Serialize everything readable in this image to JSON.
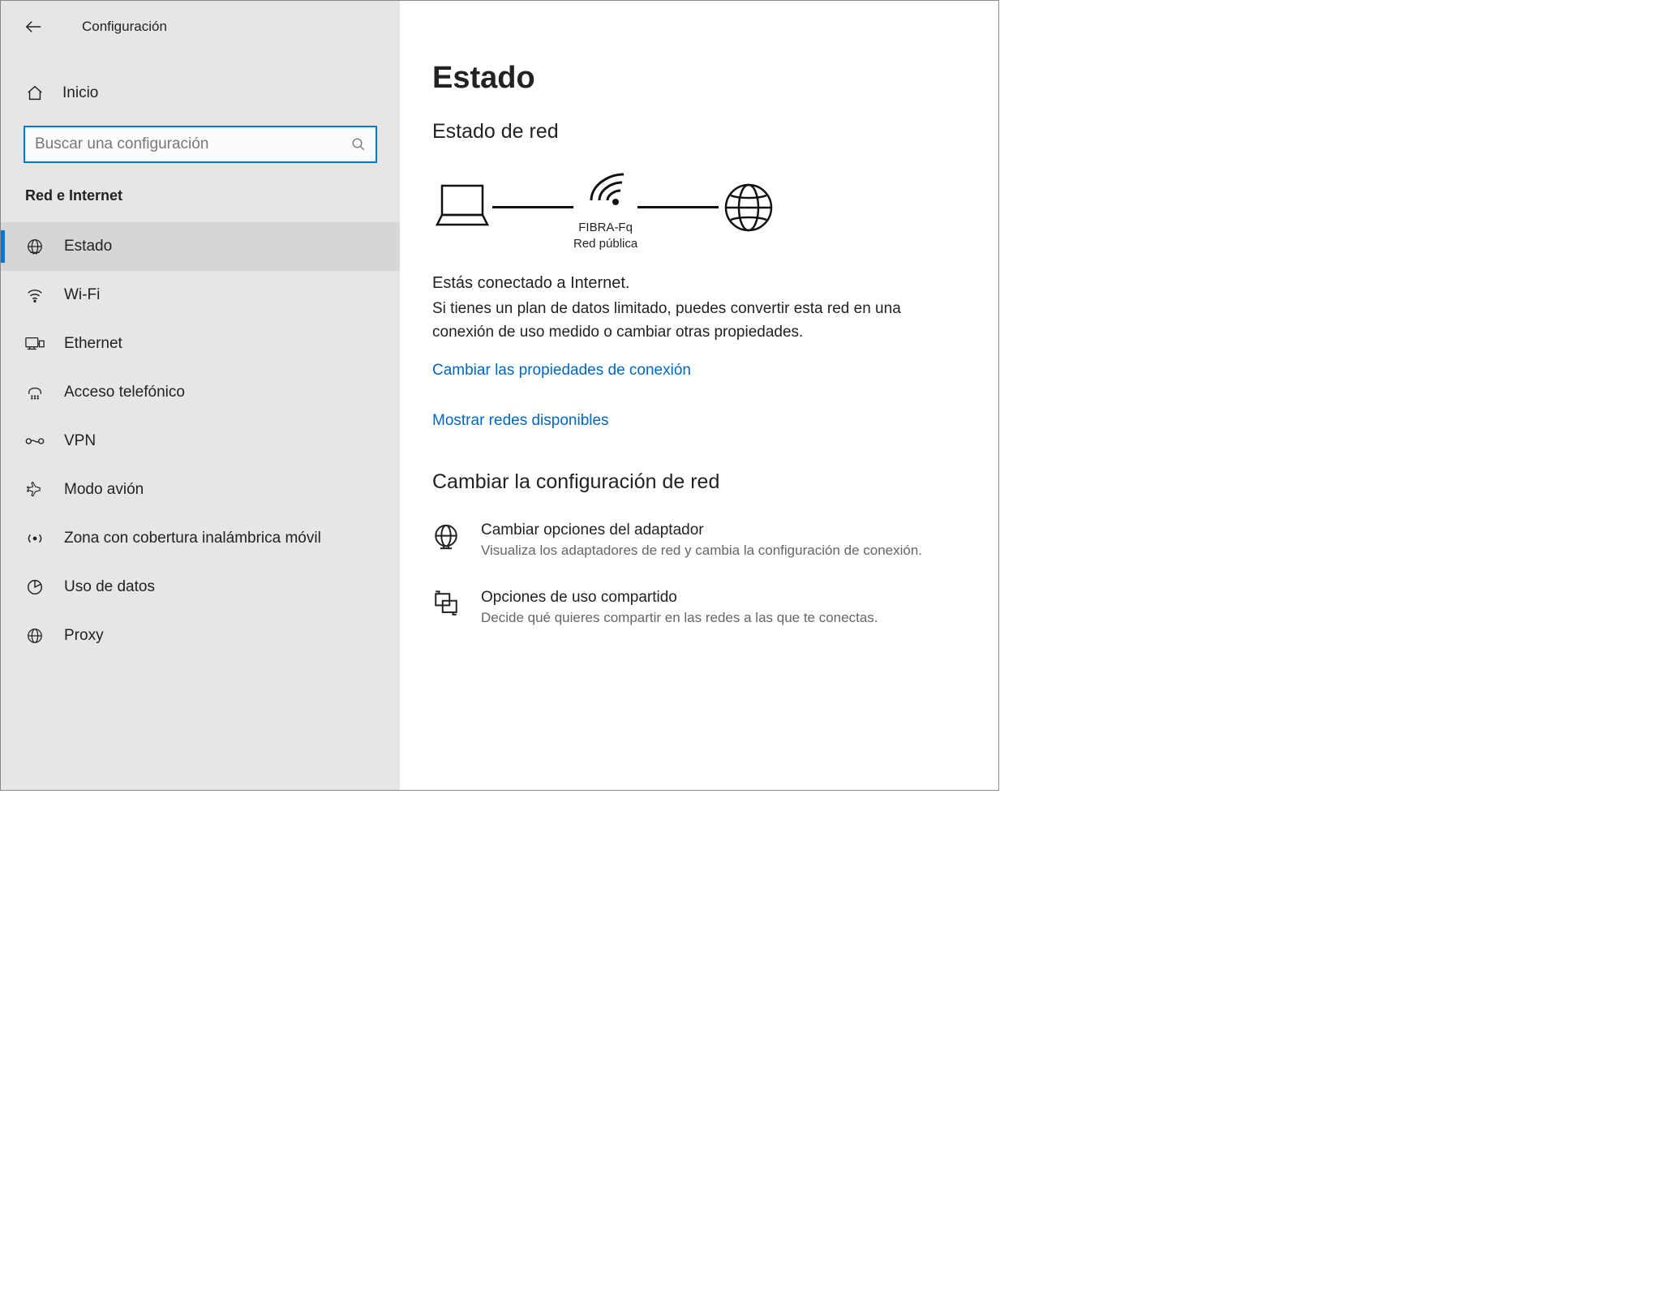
{
  "header": {
    "title": "Configuración"
  },
  "sidebar": {
    "home_label": "Inicio",
    "search_placeholder": "Buscar una configuración",
    "category_title": "Red e Internet",
    "items": [
      {
        "label": "Estado"
      },
      {
        "label": "Wi-Fi"
      },
      {
        "label": "Ethernet"
      },
      {
        "label": "Acceso telefónico"
      },
      {
        "label": "VPN"
      },
      {
        "label": "Modo avión"
      },
      {
        "label": "Zona con cobertura inalámbrica móvil"
      },
      {
        "label": "Uso de datos"
      },
      {
        "label": "Proxy"
      }
    ]
  },
  "main": {
    "page_title": "Estado",
    "section_status": "Estado de red",
    "network_name": "FIBRA-Fq",
    "network_type": "Red pública",
    "connected_heading": "Estás conectado a Internet.",
    "connected_desc": "Si tienes un plan de datos limitado, puedes convertir esta red en una conexión de uso medido o cambiar otras propiedades.",
    "link_change_props": "Cambiar las propiedades de conexión",
    "link_show_networks": "Mostrar redes disponibles",
    "section_change": "Cambiar la configuración de red",
    "options": [
      {
        "title": "Cambiar opciones del adaptador",
        "desc": "Visualiza los adaptadores de red y cambia la configuración de conexión."
      },
      {
        "title": "Opciones de uso compartido",
        "desc": "Decide qué quieres compartir en las redes a las que te conectas."
      }
    ]
  }
}
